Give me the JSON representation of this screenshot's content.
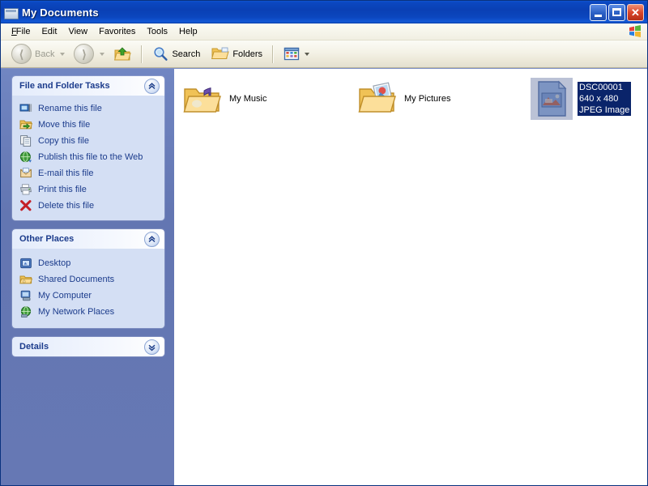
{
  "window": {
    "title": "My Documents",
    "title_icon": "documents-folder-icon",
    "buttons": {
      "minimize": "minimize-button",
      "maximize": "maximize-button",
      "close_glyph": "✕"
    }
  },
  "menubar": {
    "items": [
      {
        "label": "File",
        "accel": "F"
      },
      {
        "label": "Edit",
        "accel": "E"
      },
      {
        "label": "View",
        "accel": "V"
      },
      {
        "label": "Favorites",
        "accel": "a"
      },
      {
        "label": "Tools",
        "accel": "T"
      },
      {
        "label": "Help",
        "accel": "H"
      }
    ],
    "branding_icon": "windows-flag-icon"
  },
  "toolbar": {
    "back_label": "Back",
    "forward_label": "",
    "up_label": "",
    "search_label": "Search",
    "folders_label": "Folders",
    "views_label": ""
  },
  "sidebar": {
    "panels": [
      {
        "title": "File and Folder Tasks",
        "toggle": "chevron-up",
        "collapsed": false,
        "items": [
          {
            "label": "Rename this file",
            "icon": "rename-icon"
          },
          {
            "label": "Move this file",
            "icon": "move-icon"
          },
          {
            "label": "Copy this file",
            "icon": "copy-icon"
          },
          {
            "label": "Publish this file to the Web",
            "icon": "publish-web-icon"
          },
          {
            "label": "E-mail this file",
            "icon": "email-icon"
          },
          {
            "label": "Print this file",
            "icon": "print-icon"
          },
          {
            "label": "Delete this file",
            "icon": "delete-icon"
          }
        ]
      },
      {
        "title": "Other Places",
        "toggle": "chevron-up",
        "collapsed": false,
        "items": [
          {
            "label": "Desktop",
            "icon": "desktop-icon"
          },
          {
            "label": "Shared Documents",
            "icon": "shared-folder-icon"
          },
          {
            "label": "My Computer",
            "icon": "my-computer-icon"
          },
          {
            "label": "My Network Places",
            "icon": "network-places-icon"
          }
        ]
      },
      {
        "title": "Details",
        "toggle": "chevron-down",
        "collapsed": true,
        "items": []
      }
    ]
  },
  "content": {
    "view_mode": "tiles",
    "items": [
      {
        "name": "My Music",
        "meta": "",
        "type": "folder",
        "icon": "music-folder-icon",
        "selected": false
      },
      {
        "name": "My Pictures",
        "meta": "",
        "type": "folder",
        "icon": "pictures-folder-icon",
        "selected": false
      },
      {
        "name": "DSC00001",
        "meta": "640 x 480",
        "meta2": "JPEG Image",
        "type": "file",
        "icon": "jpeg-image-icon",
        "selected": true
      }
    ]
  },
  "colors": {
    "titlebar_blue": "#0b47c0",
    "sidebar_blue": "#6678b4",
    "panel_body": "#d4dff4",
    "link_navy": "#1c3c8c",
    "selection_navy": "#0a246a",
    "folder_yellow": "#fcd98a"
  }
}
